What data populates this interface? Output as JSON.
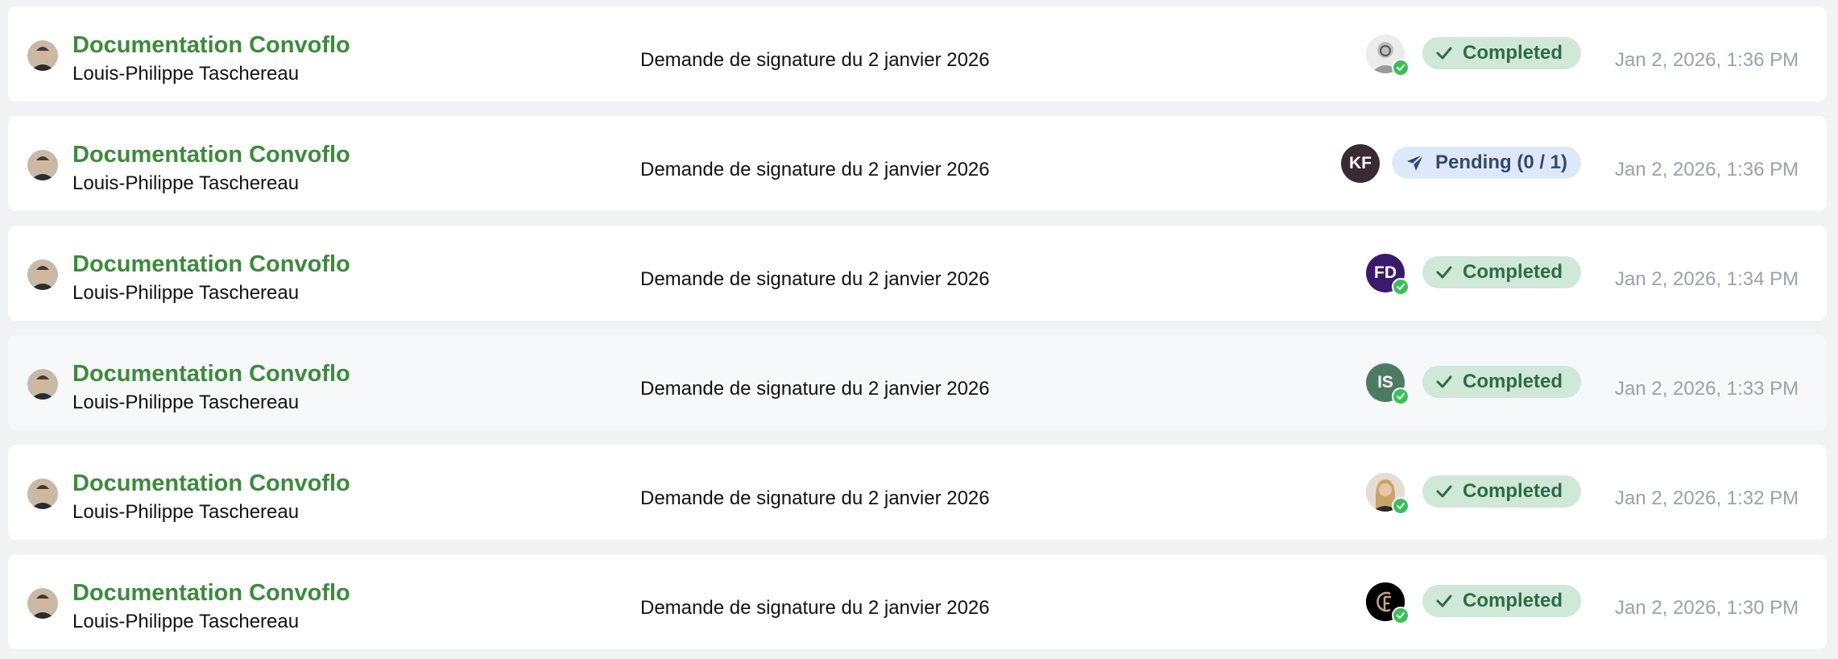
{
  "colors": {
    "page_background": "#f2f3f5",
    "title_green": "#3c8a3c",
    "completed_bg": "#cfe8d8",
    "completed_text": "#2e6b45",
    "pending_bg": "#dde9fb",
    "pending_text": "#34496a",
    "timestamp_gray": "#9aa1ab",
    "check_badge_green": "#3bbf5a"
  },
  "rows": [
    {
      "title": "Documentation Convoflo",
      "sender": "Louis-Philippe Taschereau",
      "subject": "Demande de signature du 2 janvier 2026",
      "recipient": {
        "type": "photo",
        "initials": "",
        "color": "#e8e8e8",
        "signed": true
      },
      "status": {
        "kind": "completed",
        "label": "Completed",
        "icon": "checkmark-icon"
      },
      "timestamp": "Jan 2, 2026, 1:36 PM"
    },
    {
      "title": "Documentation Convoflo",
      "sender": "Louis-Philippe Taschereau",
      "subject": "Demande de signature du 2 janvier 2026",
      "recipient": {
        "type": "initials",
        "initials": "KF",
        "color": "#3a2a33",
        "signed": false
      },
      "status": {
        "kind": "pending",
        "label": "Pending (0 / 1)",
        "icon": "paper-plane-icon"
      },
      "timestamp": "Jan 2, 2026, 1:36 PM"
    },
    {
      "title": "Documentation Convoflo",
      "sender": "Louis-Philippe Taschereau",
      "subject": "Demande de signature du 2 janvier 2026",
      "recipient": {
        "type": "initials",
        "initials": "FD",
        "color": "#3b1a6e",
        "signed": true
      },
      "status": {
        "kind": "completed",
        "label": "Completed",
        "icon": "checkmark-icon"
      },
      "timestamp": "Jan 2, 2026, 1:34 PM"
    },
    {
      "title": "Documentation Convoflo",
      "sender": "Louis-Philippe Taschereau",
      "subject": "Demande de signature du 2 janvier 2026",
      "recipient": {
        "type": "initials",
        "initials": "IS",
        "color": "#4c7a62",
        "signed": true
      },
      "status": {
        "kind": "completed",
        "label": "Completed",
        "icon": "checkmark-icon"
      },
      "timestamp": "Jan 2, 2026, 1:33 PM"
    },
    {
      "title": "Documentation Convoflo",
      "sender": "Louis-Philippe Taschereau",
      "subject": "Demande de signature du 2 janvier 2026",
      "recipient": {
        "type": "photo",
        "initials": "",
        "color": "#d9cfc4",
        "signed": true
      },
      "status": {
        "kind": "completed",
        "label": "Completed",
        "icon": "checkmark-icon"
      },
      "timestamp": "Jan 2, 2026, 1:32 PM"
    },
    {
      "title": "Documentation Convoflo",
      "sender": "Louis-Philippe Taschereau",
      "subject": "Demande de signature du 2 janvier 2026",
      "recipient": {
        "type": "logo",
        "initials": "",
        "color": "#000000",
        "signed": true
      },
      "status": {
        "kind": "completed",
        "label": "Completed",
        "icon": "checkmark-icon"
      },
      "timestamp": "Jan 2, 2026, 1:30 PM"
    }
  ]
}
